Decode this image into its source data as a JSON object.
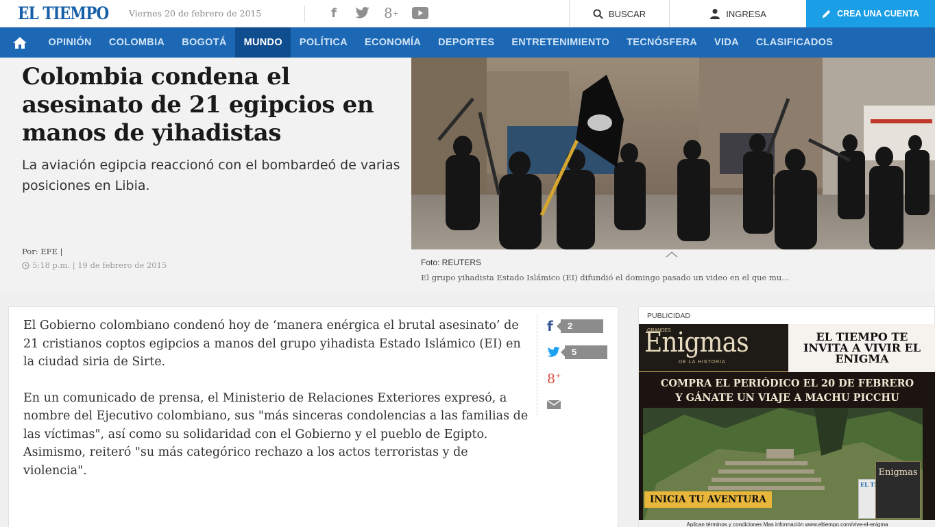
{
  "header": {
    "logo": "EL TIEMPO",
    "date": "Viernes 20 de febrero de 2015",
    "social_icons": [
      "facebook-icon",
      "twitter-icon",
      "google-plus-icon",
      "youtube-icon"
    ],
    "buscar": "BUSCAR",
    "ingresa": "INGRESA",
    "crea_cuenta": "CREA UNA CUENTA"
  },
  "nav": {
    "items": [
      "OPINIÓN",
      "COLOMBIA",
      "BOGOTÁ",
      "MUNDO",
      "POLÍTICA",
      "ECONOMÍA",
      "DEPORTES",
      "ENTRETENIMIENTO",
      "TECNÓSFERA",
      "VIDA",
      "CLASIFICADOS"
    ],
    "active": "MUNDO"
  },
  "hero": {
    "headline": "Colombia condena el asesinato de 21 egipcios en manos de yihadistas",
    "subhead": "La aviación egipcia reaccionó con el bombardeó de varias posiciones en Libia.",
    "byline": "Por: EFE |",
    "time": "5:18 p.m. | 19 de febrero de 2015",
    "photo_credit": "Foto: REUTERS",
    "photo_caption": "El grupo yihadista Estado Islámico (EI) difundió el domingo pasado un video en el que mu..."
  },
  "article": {
    "paragraphs": [
      "El Gobierno colombiano condenó hoy de ‘manera enérgica el brutal asesinato’ de 21 cristianos coptos egipcios a manos del grupo yihadista Estado Islámico (EI) en la ciudad siria de Sirte.",
      "En un comunicado de prensa, el Ministerio de Relaciones Exteriores expresó, a nombre del Ejecutivo colombiano, sus \"más sinceras condolencias a las familias de las víctimas\", así como su solidaridad con el Gobierno y el pueblo de Egipto. Asimismo, reiteró \"su más categórico rechazo a los actos terroristas y de violencia\"."
    ],
    "share": {
      "facebook_count": "2",
      "twitter_count": "5"
    }
  },
  "ad": {
    "label": "PUBLICIDAD",
    "grandes": "GRANDES",
    "brand": "Enigmas",
    "brand_sub": "DE LA HISTORIA",
    "invita": "EL TIEMPO TE INVITA A VIVIR EL ENIGMA",
    "compra_line1": "COMPRA EL PERIÓDICO EL 20 DE FEBRERO",
    "compra_line2": "Y GÁNATE UN VIAJE  A MACHU PICCHU",
    "cta": "INICIA TU AVENTURA",
    "mag_title": "Enigmas",
    "news_title": "EL TI",
    "terms": "Aplican términos y condiciones  Mas información www.eltiempo.com/vive-el-enigma"
  },
  "colors": {
    "brand_blue": "#1660a8",
    "nav_blue": "#1c68b5",
    "nav_active": "#0f4d8f",
    "cta_blue": "#1a9ee5",
    "facebook": "#3b5998",
    "twitter": "#1da1f2",
    "google_plus": "#dd4b39"
  }
}
